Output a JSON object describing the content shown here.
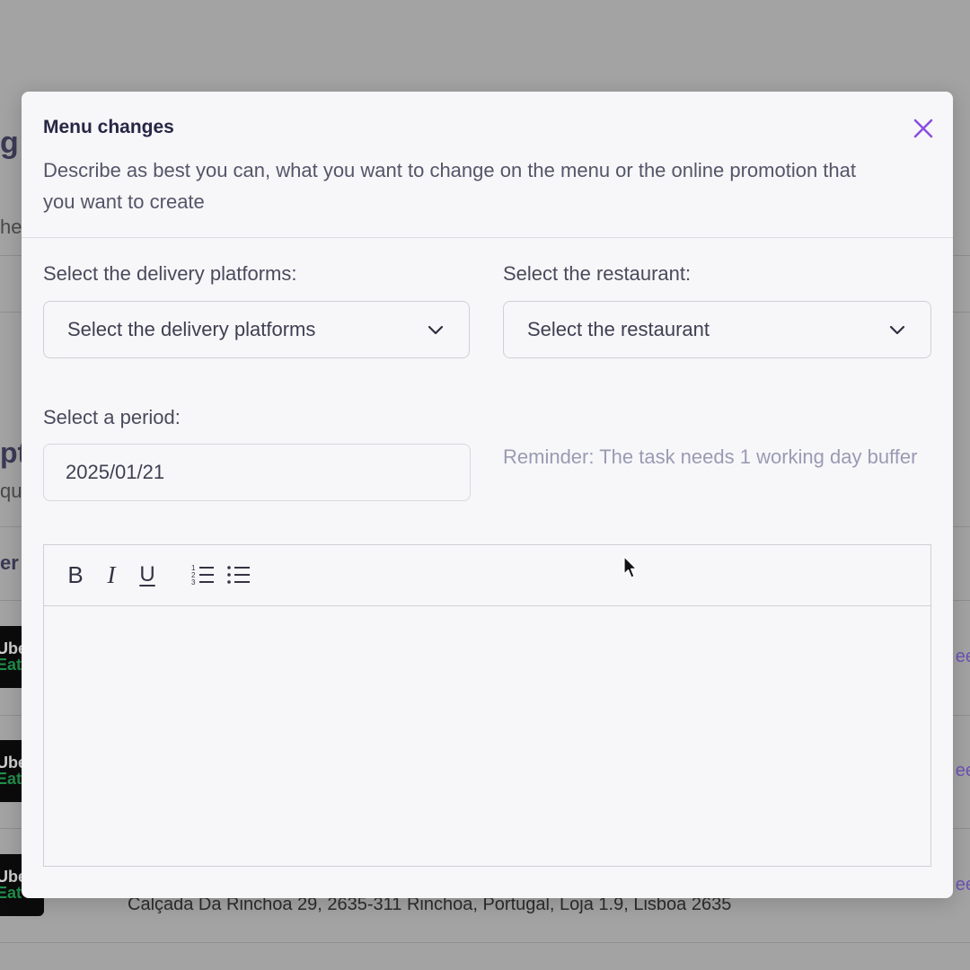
{
  "modal": {
    "title": "Menu changes",
    "description": "Describe as best you can, what you want to change on the menu or the online promotion that you want to create",
    "close_icon": "close-icon",
    "accent_color": "#8a4fe0"
  },
  "form": {
    "platforms": {
      "label": "Select the delivery platforms:",
      "value": "Select the delivery platforms"
    },
    "restaurant": {
      "label": "Select the restaurant:",
      "value": "Select the restaurant"
    },
    "period": {
      "label": "Select a period:",
      "value": "2025/01/21"
    },
    "reminder": "Reminder: The task needs 1 working day buffer"
  },
  "editor": {
    "toolbar": [
      {
        "name": "bold-button",
        "glyph": "B"
      },
      {
        "name": "italic-button",
        "glyph": "I"
      },
      {
        "name": "underline-button",
        "glyph": "U"
      },
      {
        "name": "ordered-list-button",
        "icon": "ordered-list-icon"
      },
      {
        "name": "bullet-list-button",
        "icon": "bullet-list-icon"
      }
    ],
    "content": ""
  },
  "background": {
    "address": "Calçada Da Rinchoa 29, 2635-311 Rinchoa, Portugal, Loja 1.9, Lisboa 2635",
    "heading_fragment_1": "g",
    "heading_fragment_2": "he",
    "heading_fragment_3": "pt",
    "heading_fragment_4": "qu",
    "heading_fragment_5": "er",
    "logo_text_1": "Ube",
    "logo_text_2": "Eat",
    "link_fragment": "ee"
  }
}
